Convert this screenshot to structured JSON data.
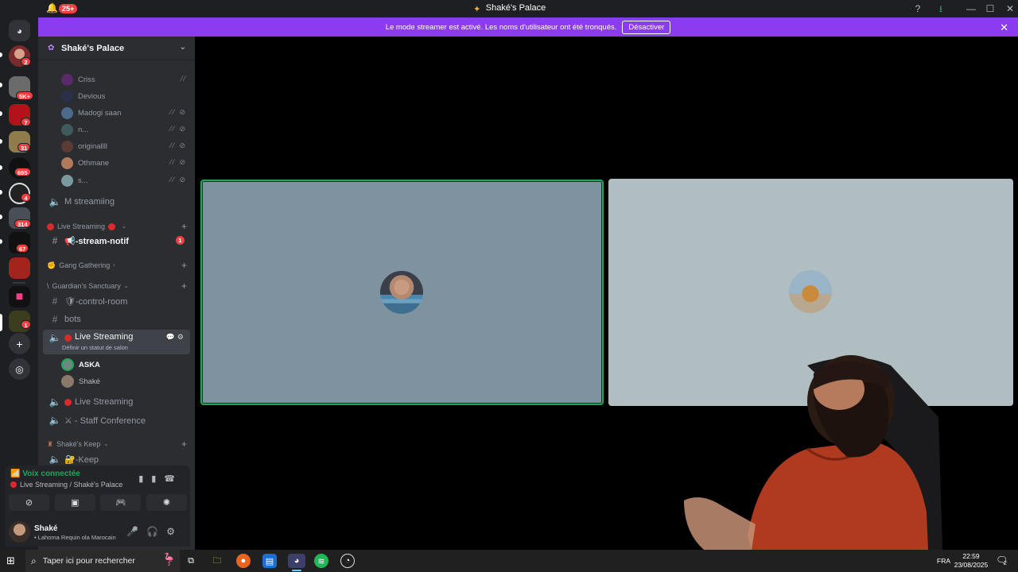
{
  "titlebar": {
    "notification_count": "25+",
    "server_title": "Shaké's Palace"
  },
  "banner": {
    "message": "Le mode streamer est activé. Les noms d'utilisateur ont été tronqués.",
    "button_label": "Désactiver"
  },
  "rail": {
    "badges": [
      "2",
      "5K+",
      "7",
      "31",
      "695",
      "4",
      "314",
      "67",
      "1"
    ]
  },
  "server": {
    "name": "Shaké's Palace"
  },
  "top_voice_users": [
    {
      "name": "Criss"
    },
    {
      "name": "Devious"
    },
    {
      "name": "Madogi saan"
    },
    {
      "name": "n..."
    },
    {
      "name": "originallll"
    },
    {
      "name": "Othmane"
    },
    {
      "name": "s..."
    }
  ],
  "channels": {
    "m_streaming": "M streamiing",
    "cat_live": "Live Streaming",
    "stream_notif": "📢-stream-notif",
    "stream_notif_mentions": "1",
    "cat_gang": "Gang Gathering",
    "cat_guardian": "Guardian's Sanctuary",
    "control_room": "🛡-control-room",
    "bots": "bots",
    "live_streaming_active": "Live Streaming",
    "live_streaming_status": "Définir un statut de salon",
    "voice_members": [
      "ASKA",
      "Shaké"
    ],
    "live_streaming_2": "Live Streaming",
    "staff_conference": "⚔ - Staff Conference",
    "cat_keep": "Shaké's Keep",
    "keep": "🔐-Keep"
  },
  "voice_panel": {
    "status": "Voix connectée",
    "location": "Live Streaming / Shaké's Palace"
  },
  "user_panel": {
    "name": "Shaké",
    "status": "• Lahoma Requin ola Marocain"
  },
  "taskbar": {
    "search_placeholder": "Taper ici pour rechercher",
    "language": "FRA",
    "time": "22:59",
    "date": "23/08/2025",
    "notif_count": "2"
  },
  "colors": {
    "banner": "#8c3cf0",
    "tile_left": "#7f929f",
    "tile_right": "#b0bec1",
    "speaking_border": "#23a55a"
  }
}
